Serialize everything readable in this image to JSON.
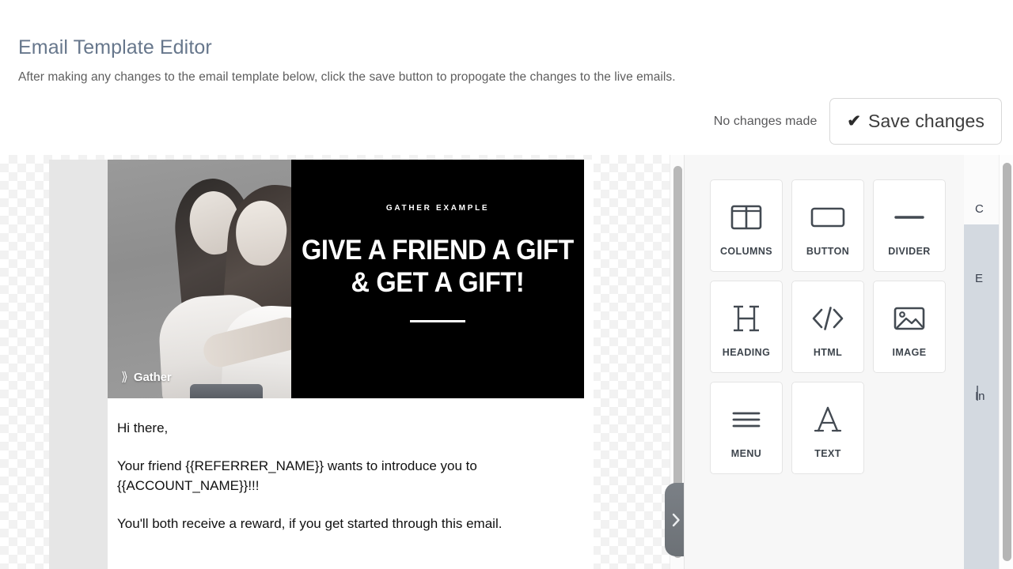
{
  "header": {
    "title": "Email Template Editor",
    "subtitle": "After making any changes to the email template below, click the save button to propogate the changes to the live emails.",
    "status_text": "No changes made",
    "save_label": "Save changes",
    "save_check_glyph": "✔"
  },
  "email_preview": {
    "hero": {
      "eyebrow": "GATHER EXAMPLE",
      "headline_line1": "GIVE A FRIEND A GIFT",
      "headline_line2": "& GET A GIFT!",
      "watermark_mark": "⟫",
      "watermark_text": "Gather",
      "photo_alt": "Two women hugging, black and white photo"
    },
    "body": [
      "Hi there,",
      "Your friend {{REFERRER_NAME}} wants to introduce you to {{ACCOUNT_NAME}}!!!",
      "You'll both receive a reward, if you get started through this email."
    ]
  },
  "palette": {
    "tiles": [
      {
        "label": "COLUMNS",
        "icon": "columns-icon"
      },
      {
        "label": "BUTTON",
        "icon": "button-icon"
      },
      {
        "label": "DIVIDER",
        "icon": "divider-icon"
      },
      {
        "label": "HEADING",
        "icon": "heading-icon"
      },
      {
        "label": "HTML",
        "icon": "code-icon"
      },
      {
        "label": "IMAGE",
        "icon": "image-icon"
      },
      {
        "label": "MENU",
        "icon": "menu-icon"
      },
      {
        "label": "TEXT",
        "icon": "text-icon"
      }
    ]
  },
  "right_panel": {
    "clipped_labels": [
      "C",
      "E",
      "In"
    ]
  },
  "colors": {
    "title": "#67778c",
    "panel_bg": "#f7f7f7",
    "tile_border": "#e4e4e4",
    "icon": "#434a52",
    "hero_panel": "#000000",
    "handle": "#7b8086"
  }
}
